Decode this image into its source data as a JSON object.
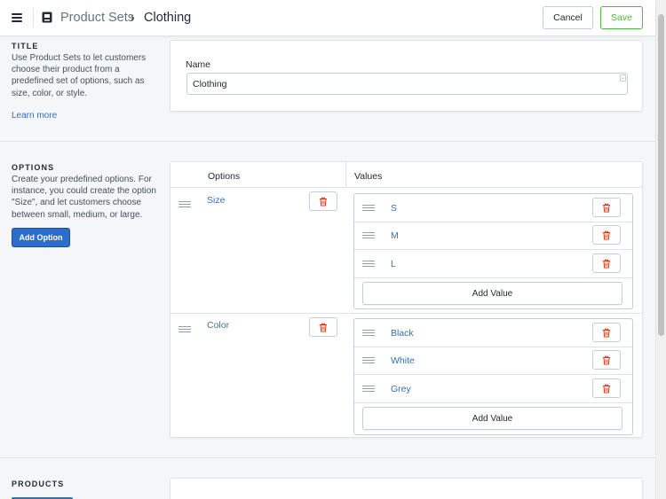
{
  "header": {
    "breadcrumb_parent": "Product Sets",
    "breadcrumb_separator": "›",
    "breadcrumb_current": "Clothing",
    "cancel_label": "Cancel",
    "save_label": "Save"
  },
  "title_section": {
    "heading": "TITLE",
    "description": "Use Product Sets to let customers choose their product from a predefined set of options, such as size, color, or style.",
    "learn_more": "Learn more",
    "name_label": "Name",
    "name_value": "Clothing"
  },
  "options_section": {
    "heading": "OPTIONS",
    "description": "Create your predefined options. For instance, you could create the option \"Size\", and let customers choose between small, medium, or large.",
    "add_option_label": "Add Option",
    "col_options": "Options",
    "col_values": "Values",
    "options": [
      {
        "name": "Size",
        "values": [
          "S",
          "M",
          "L"
        ],
        "add_value_label": "Add Value"
      },
      {
        "name": "Color",
        "values": [
          "Black",
          "White",
          "Grey"
        ],
        "add_value_label": "Add Value"
      }
    ]
  },
  "products_section": {
    "heading": "PRODUCTS"
  },
  "colors": {
    "accent_blue": "#2c6ecb",
    "link_blue": "#3670b2",
    "save_green": "#50b83c",
    "delete_red": "#de3618"
  },
  "icons": [
    "menu-icon",
    "product-sets-icon",
    "chevron-right-icon",
    "drag-handle-icon",
    "trash-icon"
  ]
}
